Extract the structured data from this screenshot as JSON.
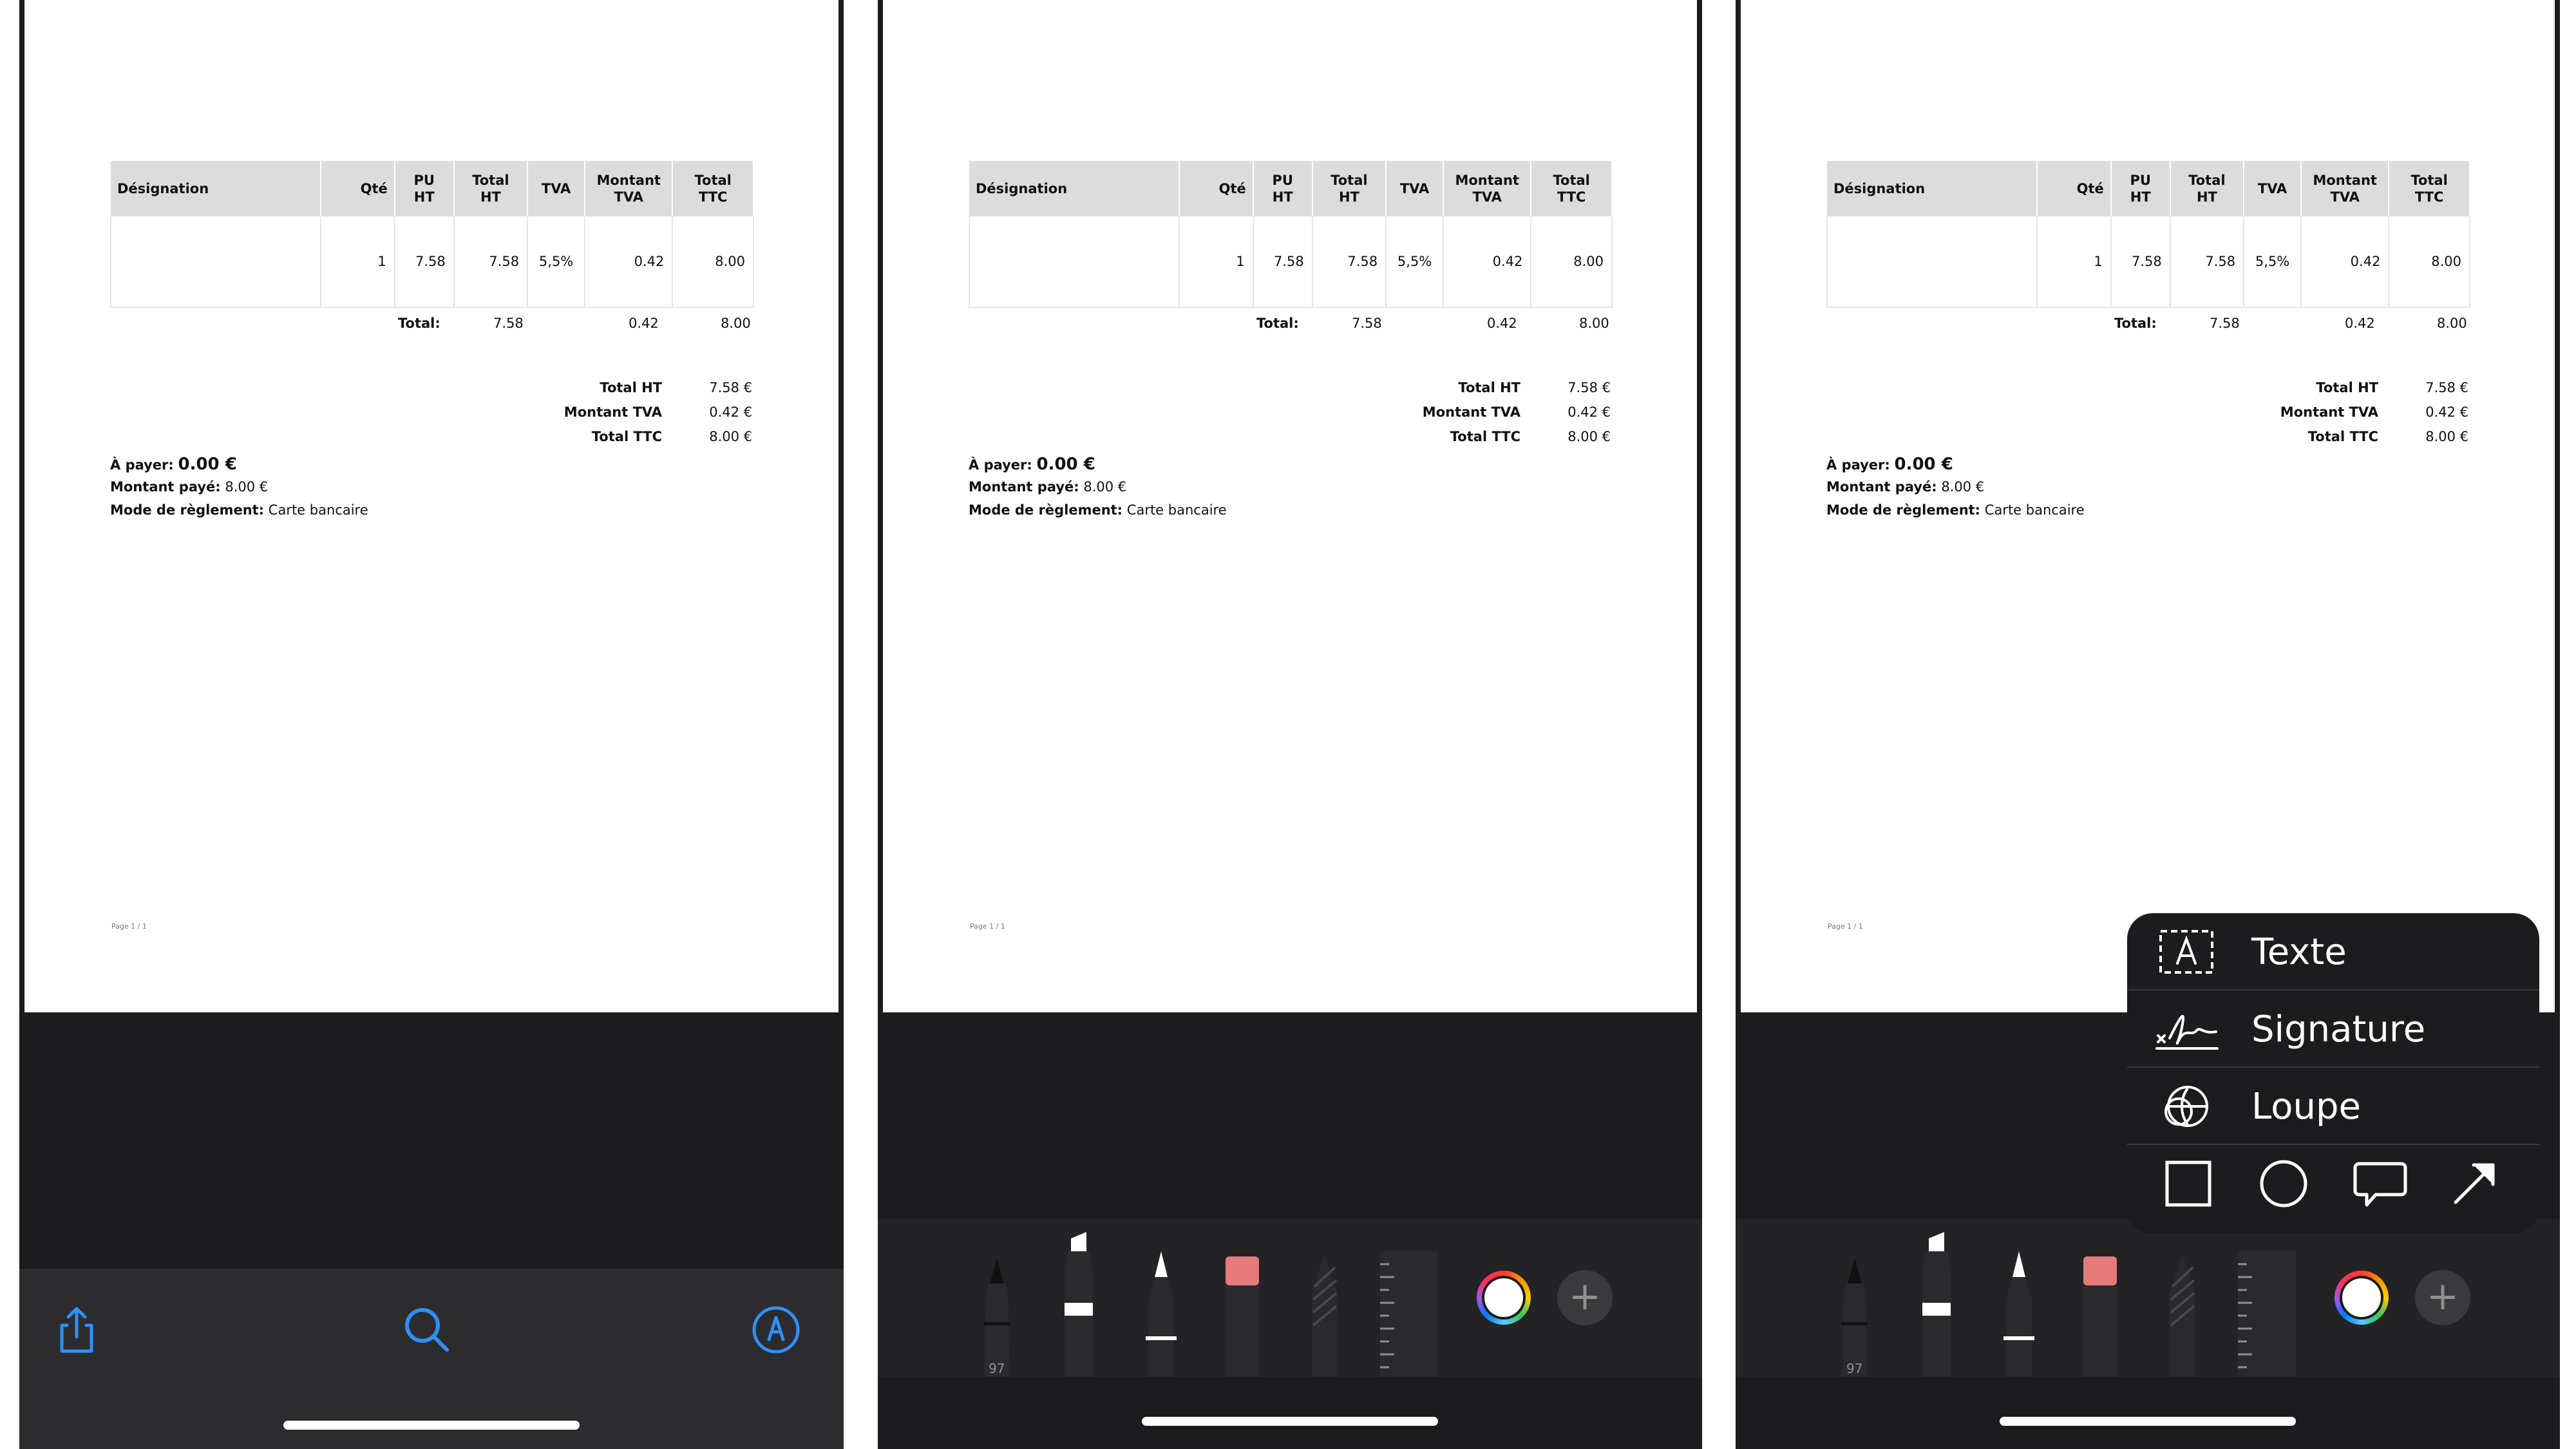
{
  "document": {
    "table_headers": [
      "Désignation",
      "Qté",
      "PU HT",
      "Total HT",
      "TVA",
      "Montant TVA",
      "Total TTC"
    ],
    "table_row": [
      "",
      "1",
      "7.58",
      "7.58",
      "5,5%",
      "0.42",
      "8.00"
    ],
    "totals_row": {
      "label": "Total:",
      "total_ht": "7.58",
      "montant_tva": "0.42",
      "total_ttc": "8.00"
    },
    "summary": [
      {
        "label": "Total HT",
        "value": "7.58 €"
      },
      {
        "label": "Montant TVA",
        "value": "0.42 €"
      },
      {
        "label": "Total TTC",
        "value": "8.00 €"
      }
    ],
    "a_payer_label": "À payer:",
    "a_payer_value": "0.00 €",
    "montant_paye_label": "Montant payé:",
    "montant_paye_value": "8.00 €",
    "mode_reglement_label": "Mode de règlement:",
    "mode_reglement_value": "Carte bancaire",
    "page_footer": "Page 1 / 1"
  },
  "viewer_toolbar": {
    "icons": [
      "share-icon",
      "search-icon",
      "markup-icon"
    ],
    "accent_color": "#2f8ff5"
  },
  "markup_toolbar": {
    "pen_width_label": "97",
    "tools": [
      "pen",
      "marker",
      "pencil",
      "eraser",
      "lasso",
      "ruler"
    ]
  },
  "add_menu": {
    "items": [
      {
        "label": "Texte",
        "icon": "text-box-icon"
      },
      {
        "label": "Signature",
        "icon": "signature-icon"
      },
      {
        "label": "Loupe",
        "icon": "magnifier-icon"
      }
    ],
    "shapes": [
      "square-icon",
      "circle-icon",
      "speech-bubble-icon",
      "arrow-icon"
    ]
  },
  "colors": {
    "background_dark": "#1c1c1e",
    "toolbar": "#2c2c2e",
    "table_header": "#dcdcdc",
    "eraser_pink": "#e47a7a"
  }
}
